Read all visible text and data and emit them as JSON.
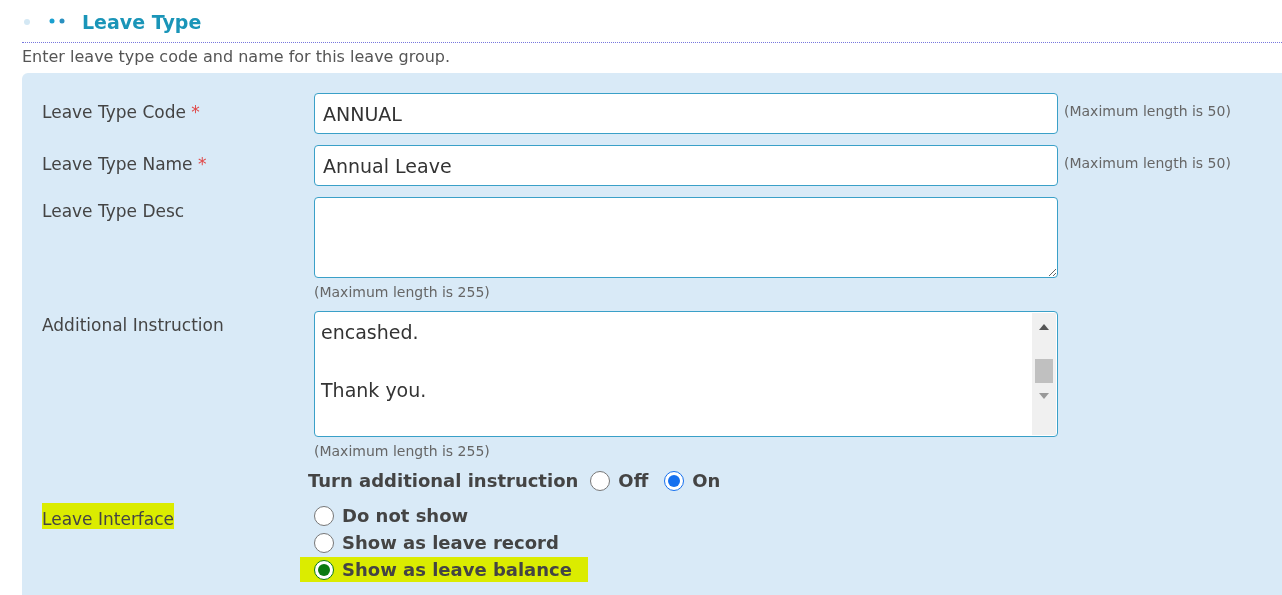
{
  "section": {
    "title": "Leave Type",
    "description": "Enter leave type code and name for this leave group."
  },
  "fields": [
    {
      "kind": "input",
      "label": "Leave Type Code",
      "required_mark": "*",
      "value": "ANNUAL",
      "hint": "(Maximum length is 50)"
    },
    {
      "kind": "input",
      "label": "Leave Type Name",
      "required_mark": "*",
      "value": "Annual Leave",
      "hint": "(Maximum length is 50)"
    },
    {
      "kind": "textarea",
      "label": "Leave Type Desc",
      "hint": "(Maximum length is 255)"
    },
    {
      "kind": "textarea",
      "label": "Additional Instruction",
      "value": "encashed.\n\nThank you.",
      "scrollbar": true,
      "hint": "(Maximum length is 255)"
    }
  ],
  "toggle": {
    "label": "Turn additional instruction",
    "options": [
      {
        "label": "Off",
        "selected": false
      },
      {
        "label": "On",
        "selected": true
      }
    ]
  },
  "leave_interface": {
    "label": "Leave Interface",
    "highlighted": true,
    "options": [
      {
        "label": "Do not show",
        "selected": false,
        "highlighted": false
      },
      {
        "label": "Show as leave record",
        "selected": false,
        "highlighted": false
      },
      {
        "label": "Show as leave balance",
        "selected": true,
        "highlighted": true
      }
    ]
  }
}
